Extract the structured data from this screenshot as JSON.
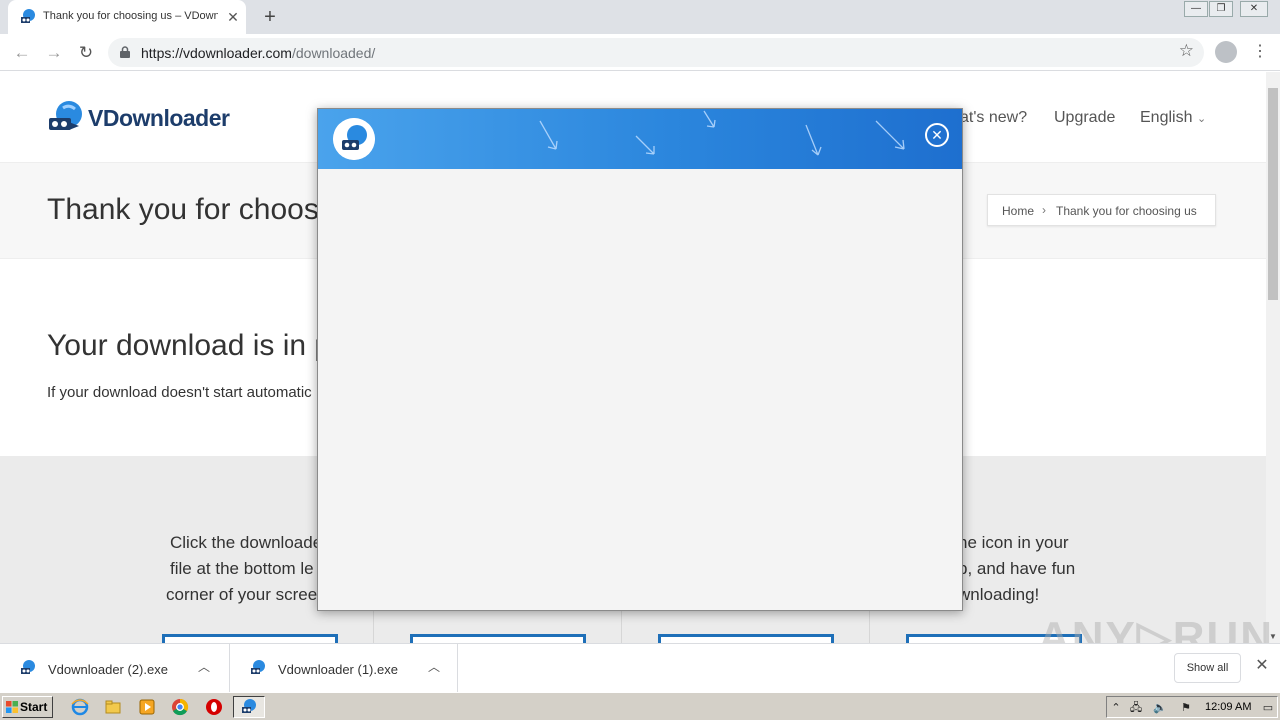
{
  "browser": {
    "tab_title": "Thank you for choosing us – VDownl",
    "tab_close": "✕",
    "new_tab": "+",
    "url_host": "https://vdownloader.com",
    "url_path": "/downloaded/",
    "window_buttons": [
      "—",
      "❐",
      "✕"
    ]
  },
  "site": {
    "logo_text": "VDownloader",
    "nav": [
      "at's new?",
      "Upgrade",
      "English"
    ],
    "hero_title": "Thank you for choos",
    "breadcrumb": {
      "home": "Home",
      "current": "Thank you for choosing us"
    },
    "download_title": "Your download is in p",
    "download_text": "If your download doesn't start automatic",
    "step1": [
      "Click the downloade",
      "file at the bottom le",
      "corner of your scree"
    ],
    "step3": [
      "he icon in your",
      "p, and have fun",
      "wnloading!"
    ]
  },
  "modal": {
    "close_label": "✕"
  },
  "downloads": {
    "items": [
      {
        "name": "Vdownloader (2).exe"
      },
      {
        "name": "Vdownloader (1).exe"
      }
    ],
    "show_all": "Show all",
    "close": "✕"
  },
  "watermark": "ANY▷RUN",
  "taskbar": {
    "start_label": "Start",
    "time": "12:09 AM"
  },
  "colors": {
    "modal_header": "#2b86dd",
    "brand": "#1d3d6b",
    "accent_blue": "#1e6fb8"
  }
}
